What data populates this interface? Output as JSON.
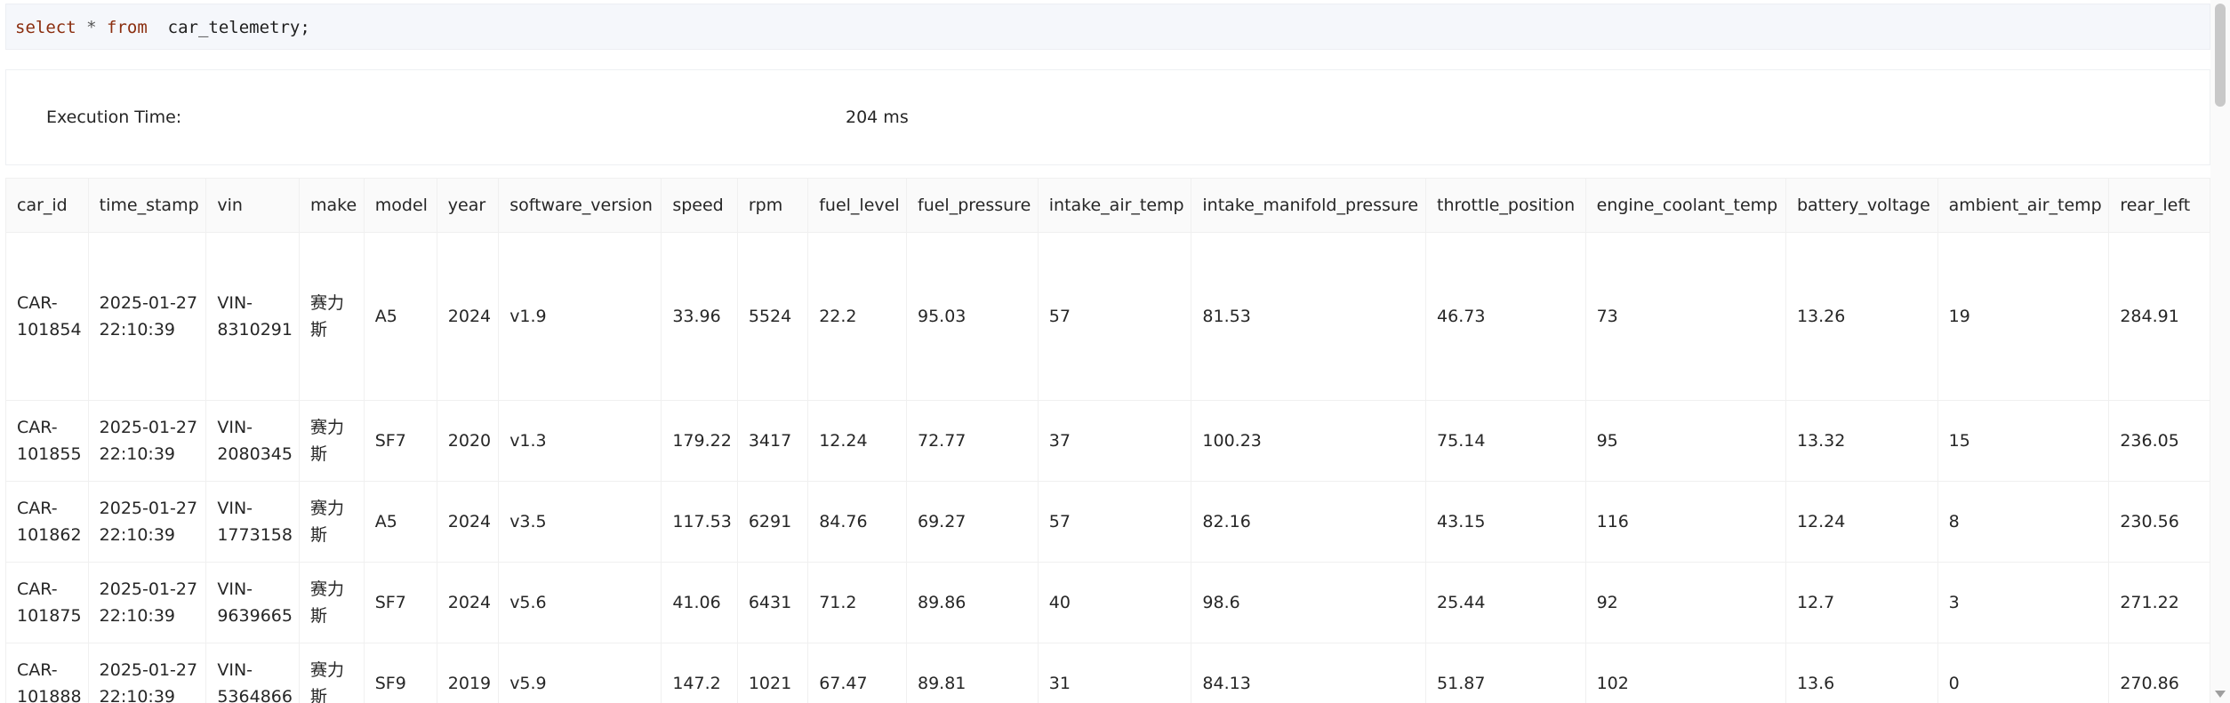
{
  "query": {
    "kw_select": "select",
    "star": "*",
    "kw_from": "from",
    "table": "car_telemetry;"
  },
  "execution": {
    "label": "Execution Time:",
    "value": "204 ms"
  },
  "table": {
    "columns": [
      "car_id",
      "time_stamp",
      "vin",
      "make",
      "model",
      "year",
      "software_version",
      "speed",
      "rpm",
      "fuel_level",
      "fuel_pressure",
      "intake_air_temp",
      "intake_manifold_pressure",
      "throttle_position",
      "engine_coolant_temp",
      "battery_voltage",
      "ambient_air_temp",
      "rear_left"
    ],
    "rows": [
      [
        "CAR-101854",
        "2025-01-27 22:10:39",
        "VIN-8310291",
        "赛力斯",
        "A5",
        "2024",
        "v1.9",
        "33.96",
        "5524",
        "22.2",
        "95.03",
        "57",
        "81.53",
        "46.73",
        "73",
        "13.26",
        "19",
        "284.91"
      ],
      [
        "CAR-101855",
        "2025-01-27 22:10:39",
        "VIN-2080345",
        "赛力斯",
        "SF7",
        "2020",
        "v1.3",
        "179.22",
        "3417",
        "12.24",
        "72.77",
        "37",
        "100.23",
        "75.14",
        "95",
        "13.32",
        "15",
        "236.05"
      ],
      [
        "CAR-101862",
        "2025-01-27 22:10:39",
        "VIN-1773158",
        "赛力斯",
        "A5",
        "2024",
        "v3.5",
        "117.53",
        "6291",
        "84.76",
        "69.27",
        "57",
        "82.16",
        "43.15",
        "116",
        "12.24",
        "8",
        "230.56"
      ],
      [
        "CAR-101875",
        "2025-01-27 22:10:39",
        "VIN-9639665",
        "赛力斯",
        "SF7",
        "2024",
        "v5.6",
        "41.06",
        "6431",
        "71.2",
        "89.86",
        "40",
        "98.6",
        "25.44",
        "92",
        "12.7",
        "3",
        "271.22"
      ],
      [
        "CAR-101888",
        "2025-01-27 22:10:39",
        "VIN-5364866",
        "赛力斯",
        "SF9",
        "2019",
        "v5.9",
        "147.2",
        "1021",
        "67.47",
        "89.81",
        "31",
        "84.13",
        "51.87",
        "102",
        "13.6",
        "0",
        "270.86"
      ]
    ]
  }
}
